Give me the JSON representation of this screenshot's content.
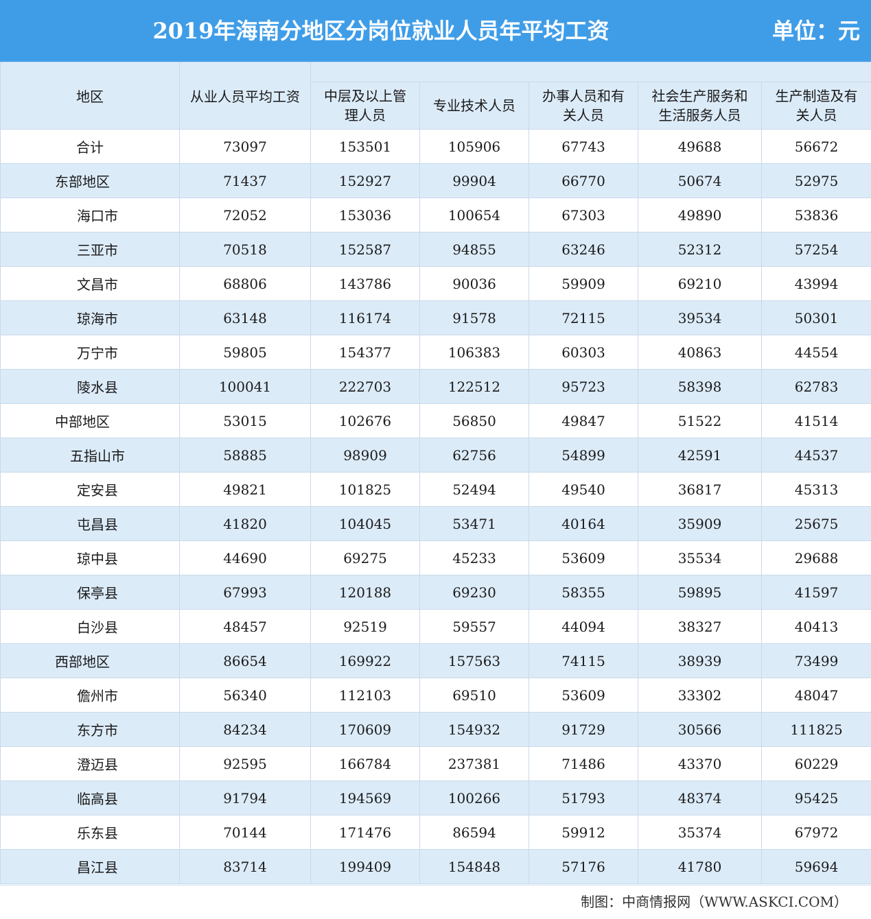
{
  "header": {
    "title": "2019年海南分地区分岗位就业人员年平均工资",
    "unit": "单位：元"
  },
  "footer": {
    "source": "制图：中商情报网（WWW.ASKCI.COM）"
  },
  "colors": {
    "title_bar": "#3f9de8",
    "stripe": "#dcebf8",
    "grid": "#c9d9ea"
  },
  "chart_data": {
    "type": "table",
    "title": "2019年海南分地区分岗位就业人员年平均工资",
    "unit": "单位：元",
    "columns": [
      "地区",
      "从业人员平均工资",
      "中层及以上管理人员",
      "专业技术人员",
      "办事人员和有关人员",
      "社会生产服务和生活服务人员",
      "生产制造及有关人员"
    ],
    "column_labels": [
      "地区",
      "从业人员平均工资",
      [
        "中层及以上管",
        "理人员"
      ],
      "专业技术人员",
      [
        "办事人员和有",
        "关人员"
      ],
      [
        "社会生产服务和",
        "生活服务人员"
      ],
      [
        "生产制造及有",
        "关人员"
      ]
    ],
    "rows": [
      {
        "region": "合计",
        "level": "total",
        "values": [
          73097,
          153501,
          105906,
          67743,
          49688,
          56672
        ]
      },
      {
        "region": "东部地区",
        "level": "main",
        "values": [
          71437,
          152927,
          99904,
          66770,
          50674,
          52975
        ]
      },
      {
        "region": "海口市",
        "level": "sub",
        "values": [
          72052,
          153036,
          100654,
          67303,
          49890,
          53836
        ]
      },
      {
        "region": "三亚市",
        "level": "sub",
        "values": [
          70518,
          152587,
          94855,
          63246,
          52312,
          57254
        ]
      },
      {
        "region": "文昌市",
        "level": "sub",
        "values": [
          68806,
          143786,
          90036,
          59909,
          69210,
          43994
        ]
      },
      {
        "region": "琼海市",
        "level": "sub",
        "values": [
          63148,
          116174,
          91578,
          72115,
          39534,
          50301
        ]
      },
      {
        "region": "万宁市",
        "level": "sub",
        "values": [
          59805,
          154377,
          106383,
          60303,
          40863,
          44554
        ]
      },
      {
        "region": "陵水县",
        "level": "sub",
        "values": [
          100041,
          222703,
          122512,
          95723,
          58398,
          62783
        ]
      },
      {
        "region": "中部地区",
        "level": "main",
        "values": [
          53015,
          102676,
          56850,
          49847,
          51522,
          41514
        ]
      },
      {
        "region": "五指山市",
        "level": "sub",
        "values": [
          58885,
          98909,
          62756,
          54899,
          42591,
          44537
        ]
      },
      {
        "region": "定安县",
        "level": "sub",
        "values": [
          49821,
          101825,
          52494,
          49540,
          36817,
          45313
        ]
      },
      {
        "region": "屯昌县",
        "level": "sub",
        "values": [
          41820,
          104045,
          53471,
          40164,
          35909,
          25675
        ]
      },
      {
        "region": "琼中县",
        "level": "sub",
        "values": [
          44690,
          69275,
          45233,
          53609,
          35534,
          29688
        ]
      },
      {
        "region": "保亭县",
        "level": "sub",
        "values": [
          67993,
          120188,
          69230,
          58355,
          59895,
          41597
        ]
      },
      {
        "region": "白沙县",
        "level": "sub",
        "values": [
          48457,
          92519,
          59557,
          44094,
          38327,
          40413
        ]
      },
      {
        "region": "西部地区",
        "level": "main",
        "values": [
          86654,
          169922,
          157563,
          74115,
          38939,
          73499
        ]
      },
      {
        "region": "儋州市",
        "level": "sub",
        "values": [
          56340,
          112103,
          69510,
          53609,
          33302,
          48047
        ]
      },
      {
        "region": "东方市",
        "level": "sub",
        "values": [
          84234,
          170609,
          154932,
          91729,
          30566,
          111825
        ]
      },
      {
        "region": "澄迈县",
        "level": "sub",
        "values": [
          92595,
          166784,
          237381,
          71486,
          43370,
          60229
        ]
      },
      {
        "region": "临高县",
        "level": "sub",
        "values": [
          91794,
          194569,
          100266,
          51793,
          48374,
          95425
        ]
      },
      {
        "region": "乐东县",
        "level": "sub",
        "values": [
          70144,
          171476,
          86594,
          59912,
          35374,
          67972
        ]
      },
      {
        "region": "昌江县",
        "level": "sub",
        "values": [
          83714,
          199409,
          154848,
          57176,
          41780,
          59694
        ]
      }
    ]
  }
}
